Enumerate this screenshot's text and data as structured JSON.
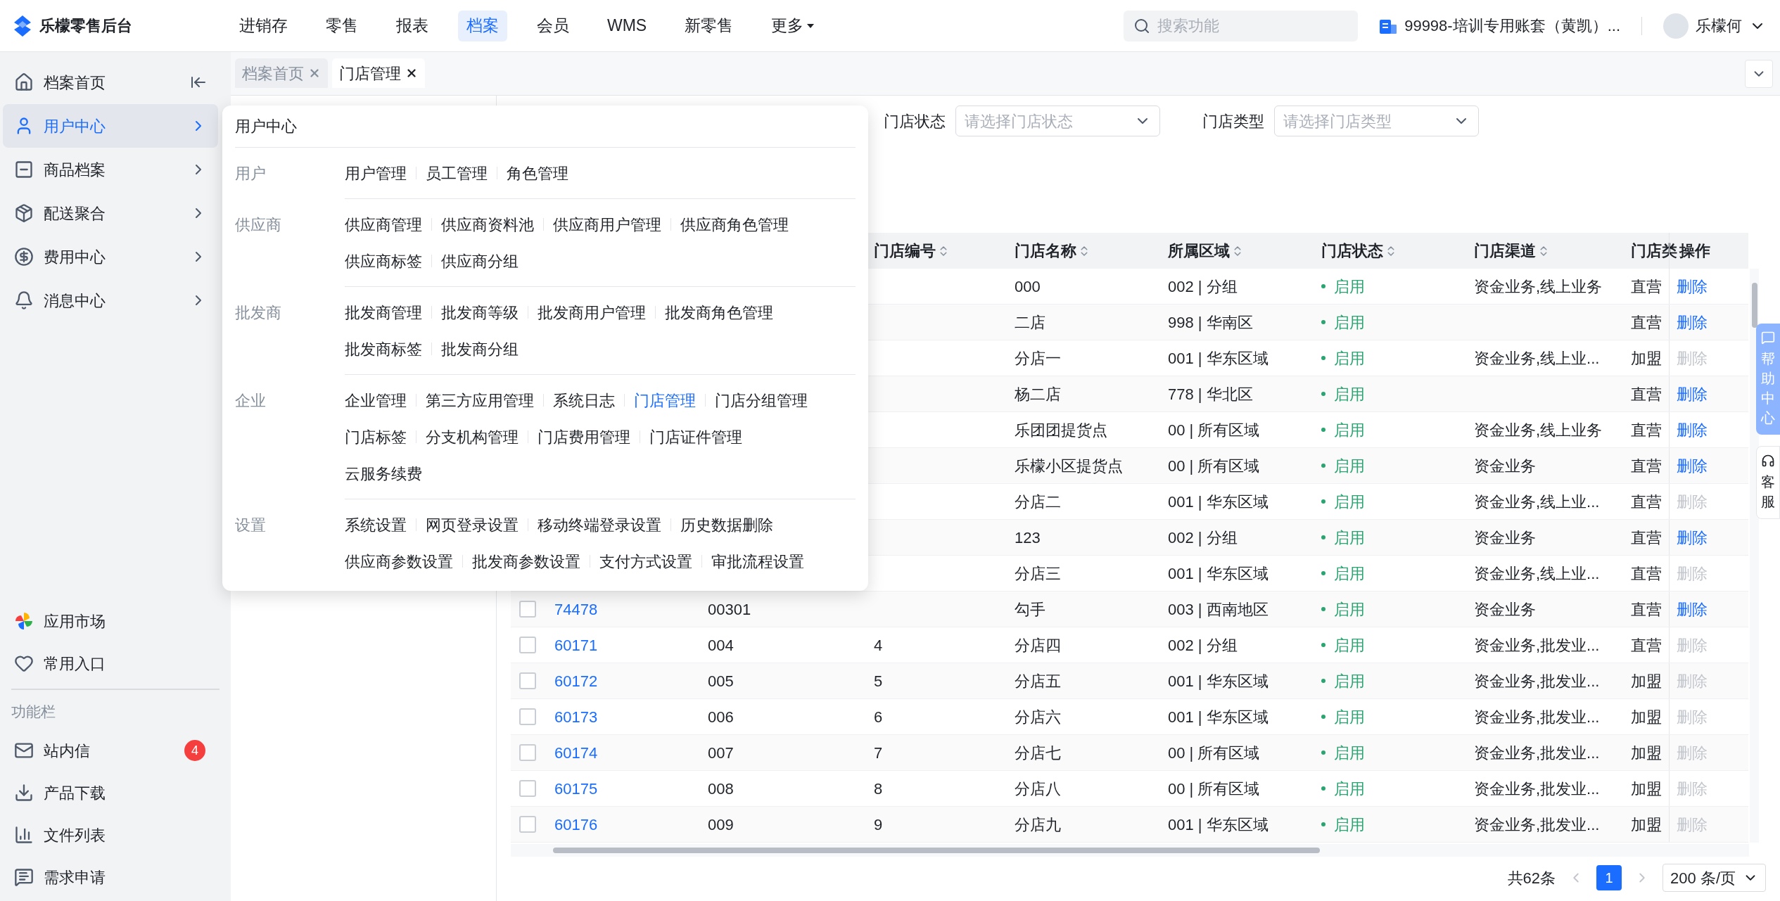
{
  "top_bar": {
    "logo": "乐檬零售后台",
    "nav": [
      {
        "label": "进销存",
        "selected": false,
        "caret": false
      },
      {
        "label": "零售",
        "selected": false,
        "caret": false
      },
      {
        "label": "报表",
        "selected": false,
        "caret": false
      },
      {
        "label": "档案",
        "selected": true,
        "caret": false
      },
      {
        "label": "会员",
        "selected": false,
        "caret": false
      },
      {
        "label": "WMS",
        "selected": false,
        "caret": false
      },
      {
        "label": "新零售",
        "selected": false,
        "caret": false
      },
      {
        "label": "更多",
        "selected": false,
        "caret": true
      }
    ],
    "search": {
      "placeholder": "搜索功能"
    },
    "account": "99998-培训专用账套（黄凯）...",
    "user": "乐檬何"
  },
  "sidebar": {
    "items": [
      {
        "label": "档案首页",
        "kind": "home",
        "selected": false
      },
      {
        "label": "用户中心",
        "kind": "group",
        "selected": true
      },
      {
        "label": "商品档案",
        "kind": "group",
        "selected": false
      },
      {
        "label": "配送聚合",
        "kind": "group",
        "selected": false
      },
      {
        "label": "费用中心",
        "kind": "group",
        "selected": false
      },
      {
        "label": "消息中心",
        "kind": "group",
        "selected": false
      }
    ],
    "shortcuts": [
      {
        "label": "应用市场"
      },
      {
        "label": "常用入口"
      }
    ],
    "section_label": "功能栏",
    "tools": [
      {
        "label": "站内信",
        "badge": "4"
      },
      {
        "label": "产品下载"
      },
      {
        "label": "文件列表"
      },
      {
        "label": "需求申请"
      }
    ]
  },
  "tabs": [
    {
      "label": "档案首页",
      "selected": false
    },
    {
      "label": "门店管理",
      "selected": true
    }
  ],
  "filters": [
    {
      "label": "门店状态",
      "placeholder": "请选择门店状态"
    },
    {
      "label": "门店类型",
      "placeholder": "请选择门店类型"
    }
  ],
  "table": {
    "columns": [
      {
        "label": "门店编号",
        "sortable": true
      },
      {
        "label": "门店名称",
        "sortable": true
      },
      {
        "label": "所属区域",
        "sortable": true
      },
      {
        "label": "门店状态",
        "sortable": true
      },
      {
        "label": "门店渠道",
        "sortable": true
      },
      {
        "label": "门店类"
      },
      {
        "label": "操作"
      }
    ],
    "rows": [
      {
        "name": "000",
        "region": "002 | 分组",
        "status": "启用",
        "channel": "资金业务,线上业务",
        "type": "直营",
        "action": "删除",
        "action_disabled": false
      },
      {
        "name": "二店",
        "region": "998 | 华南区",
        "status": "启用",
        "type": "直营",
        "action": "删除",
        "action_disabled": false
      },
      {
        "name": "分店一",
        "region": "001 | 华东区域",
        "status": "启用",
        "channel": "资金业务,线上业...",
        "type": "加盟",
        "action": "删除",
        "action_disabled": true
      },
      {
        "name": "杨二店",
        "region": "778 | 华北区",
        "status": "启用",
        "type": "直营",
        "action": "删除",
        "action_disabled": false
      },
      {
        "name": "乐团团提货点",
        "region": "00 | 所有区域",
        "status": "启用",
        "channel": "资金业务,线上业务",
        "type": "直营",
        "action": "删除",
        "action_disabled": false
      },
      {
        "name": "乐檬小区提货点",
        "region": "00 | 所有区域",
        "status": "启用",
        "channel": "资金业务",
        "type": "直营",
        "action": "删除",
        "action_disabled": false
      },
      {
        "name": "分店二",
        "region": "001 | 华东区域",
        "status": "启用",
        "channel": "资金业务,线上业...",
        "type": "直营",
        "action": "删除",
        "action_disabled": true
      },
      {
        "name": "123",
        "region": "002 | 分组",
        "status": "启用",
        "channel": "资金业务",
        "type": "直营",
        "action": "删除",
        "action_disabled": false
      },
      {
        "name": "分店三",
        "region": "001 | 华东区域",
        "status": "启用",
        "channel": "资金业务,线上业...",
        "type": "直营",
        "action": "删除",
        "action_disabled": true
      },
      {
        "checked": false,
        "column_1": "74478",
        "column_2": "00301",
        "name": "勾手",
        "region": "003 | 西南地区",
        "status": "启用",
        "channel": "资金业务",
        "type": "直营",
        "action": "删除",
        "action_disabled": false
      },
      {
        "checked": false,
        "column_1": "60171",
        "column_2": "004",
        "code": "4",
        "name": "分店四",
        "region": "002 | 分组",
        "status": "启用",
        "channel": "资金业务,批发业...",
        "type": "直营",
        "action": "删除",
        "action_disabled": true
      },
      {
        "checked": false,
        "column_1": "60172",
        "column_2": "005",
        "code": "5",
        "name": "分店五",
        "region": "001 | 华东区域",
        "status": "启用",
        "channel": "资金业务,批发业...",
        "type": "加盟",
        "action": "删除",
        "action_disabled": true
      },
      {
        "checked": false,
        "column_1": "60173",
        "column_2": "006",
        "code": "6",
        "name": "分店六",
        "region": "001 | 华东区域",
        "status": "启用",
        "channel": "资金业务,批发业...",
        "type": "加盟",
        "action": "删除",
        "action_disabled": true
      },
      {
        "checked": false,
        "column_1": "60174",
        "column_2": "007",
        "code": "7",
        "name": "分店七",
        "region": "00 | 所有区域",
        "status": "启用",
        "channel": "资金业务,批发业...",
        "type": "加盟",
        "action": "删除",
        "action_disabled": true
      },
      {
        "checked": false,
        "column_1": "60175",
        "column_2": "008",
        "code": "8",
        "name": "分店八",
        "region": "00 | 所有区域",
        "status": "启用",
        "channel": "资金业务,批发业...",
        "type": "加盟",
        "action": "删除",
        "action_disabled": true
      },
      {
        "checked": false,
        "column_1": "60176",
        "column_2": "009",
        "code": "9",
        "name": "分店九",
        "region": "001 | 华东区域",
        "status": "启用",
        "channel": "资金业务,批发业...",
        "type": "加盟",
        "action": "删除",
        "action_disabled": true
      }
    ]
  },
  "pagination": {
    "total": "共62条",
    "pages": [
      {
        "label": "1",
        "selected": true
      }
    ],
    "page_size": "200 条/页"
  },
  "popup_menu": {
    "title": "用户中心",
    "groups": [
      {
        "label": "用户",
        "lines": [
          [
            {
              "label": "用户管理",
              "selected": false
            },
            {
              "label": "员工管理",
              "selected": false
            },
            {
              "label": "角色管理",
              "selected": false
            }
          ]
        ]
      },
      {
        "label": "供应商",
        "lines": [
          [
            {
              "label": "供应商管理",
              "selected": false
            },
            {
              "label": "供应商资料池",
              "selected": false
            },
            {
              "label": "供应商用户管理",
              "selected": false
            },
            {
              "label": "供应商角色管理",
              "selected": false
            }
          ],
          [
            {
              "label": "供应商标签",
              "selected": false
            },
            {
              "label": "供应商分组",
              "selected": false
            }
          ]
        ]
      },
      {
        "label": "批发商",
        "lines": [
          [
            {
              "label": "批发商管理",
              "selected": false
            },
            {
              "label": "批发商等级",
              "selected": false
            },
            {
              "label": "批发商用户管理",
              "selected": false
            },
            {
              "label": "批发商角色管理",
              "selected": false
            }
          ],
          [
            {
              "label": "批发商标签",
              "selected": false
            },
            {
              "label": "批发商分组",
              "selected": false
            }
          ]
        ]
      },
      {
        "label": "企业",
        "lines": [
          [
            {
              "label": "企业管理",
              "selected": false
            },
            {
              "label": "第三方应用管理",
              "selected": false
            },
            {
              "label": "系统日志",
              "selected": false
            },
            {
              "label": "门店管理",
              "selected": true
            },
            {
              "label": "门店分组管理",
              "selected": false
            }
          ],
          [
            {
              "label": "门店标签",
              "selected": false
            },
            {
              "label": "分支机构管理",
              "selected": false
            },
            {
              "label": "门店费用管理",
              "selected": false
            },
            {
              "label": "门店证件管理",
              "selected": false
            }
          ],
          [
            {
              "label": "云服务续费",
              "selected": false
            }
          ]
        ]
      },
      {
        "label": "设置",
        "lines": [
          [
            {
              "label": "系统设置",
              "selected": false
            },
            {
              "label": "网页登录设置",
              "selected": false
            },
            {
              "label": "移动终端登录设置",
              "selected": false
            },
            {
              "label": "历史数据删除",
              "selected": false
            }
          ],
          [
            {
              "label": "供应商参数设置",
              "selected": false
            },
            {
              "label": "批发商参数设置",
              "selected": false
            },
            {
              "label": "支付方式设置",
              "selected": false
            },
            {
              "label": "审批流程设置",
              "selected": false
            }
          ]
        ]
      }
    ]
  },
  "side_tabs": [
    {
      "label": "帮助中心",
      "kind": "help"
    },
    {
      "label": "客服",
      "kind": "service"
    }
  ]
}
